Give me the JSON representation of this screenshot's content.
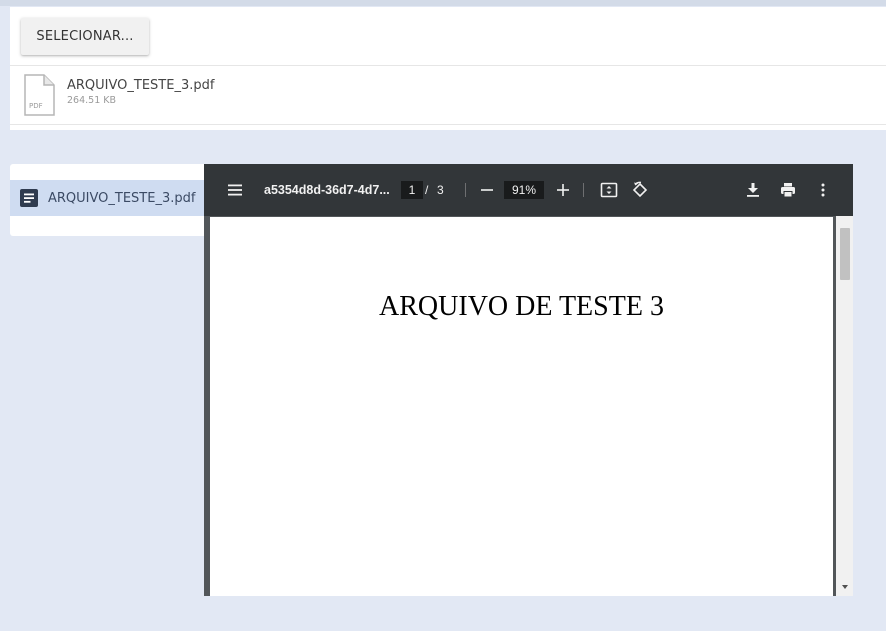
{
  "upload": {
    "select_button": "SELECIONAR...",
    "file": {
      "name": "ARQUIVO_TESTE_3.pdf",
      "size": "264.51 KB",
      "icon": "pdf-file-icon",
      "icon_label": "PDF"
    }
  },
  "file_list": {
    "items": [
      {
        "label": "ARQUIVO_TESTE_3.pdf",
        "icon": "document-icon",
        "selected": true
      }
    ]
  },
  "viewer": {
    "title": "a5354d8d-36d7-4d7...",
    "page_current": "1",
    "page_separator": "/",
    "page_total": "3",
    "zoom": "91%",
    "document_heading": "ARQUIVO DE TESTE 3"
  },
  "colors": {
    "background": "#e2e8f4",
    "selected_item": "#cfdcf1",
    "viewer_toolbar": "#323639",
    "viewer_bg": "#525659"
  }
}
